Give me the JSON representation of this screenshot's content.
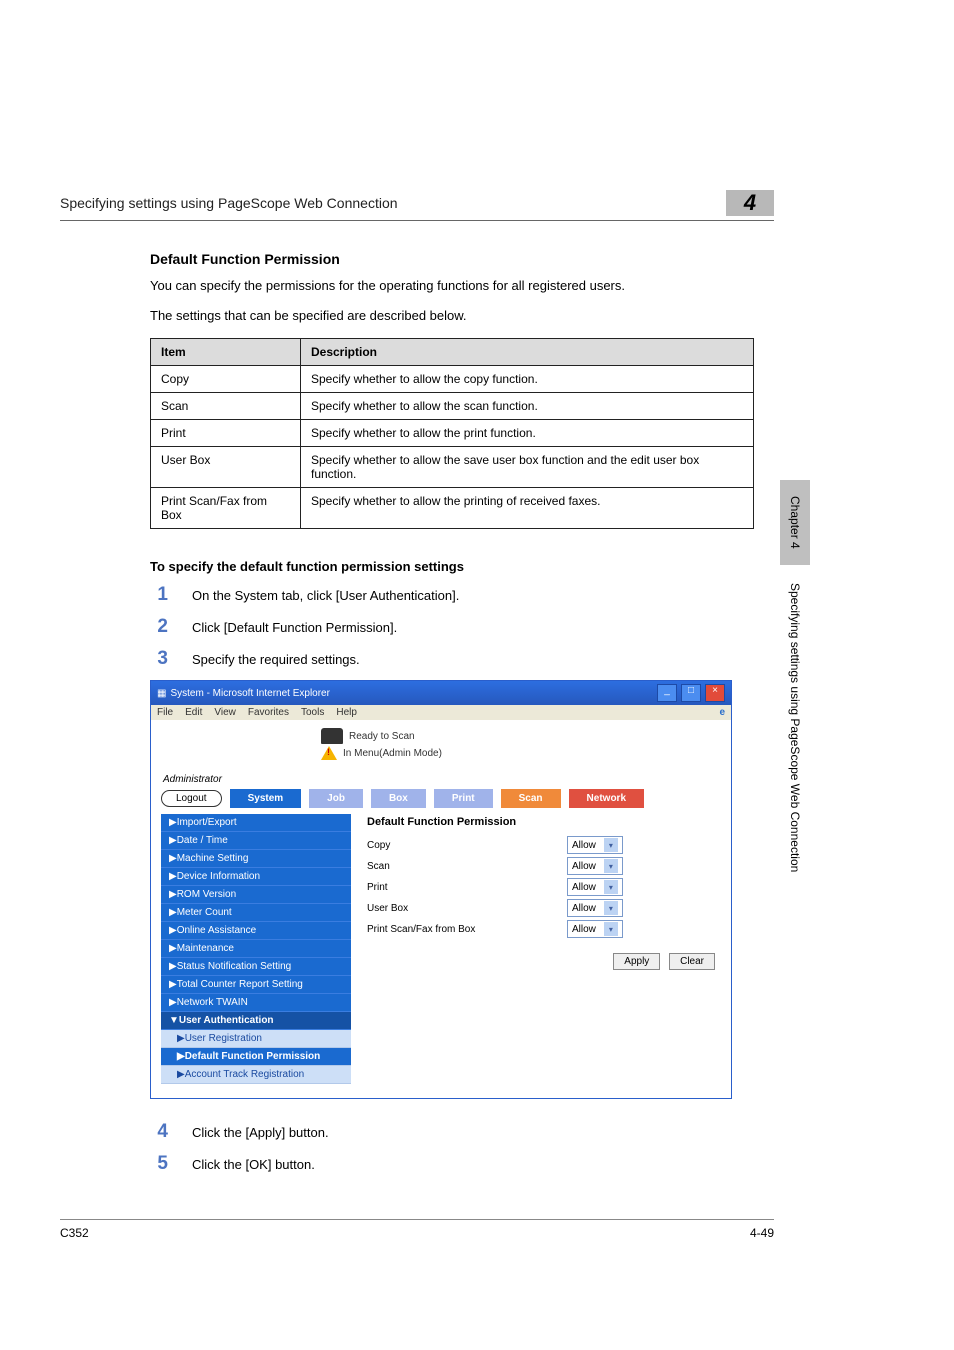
{
  "header": {
    "title": "Specifying settings using PageScope Web Connection",
    "chapter_number": "4"
  },
  "section": {
    "title": "Default Function Permission",
    "para1": "You can specify the permissions for the operating functions for all registered users.",
    "para2": "The settings that can be specified are described below."
  },
  "spec_table": {
    "headers": [
      "Item",
      "Description"
    ],
    "rows": [
      [
        "Copy",
        "Specify whether to allow the copy function."
      ],
      [
        "Scan",
        "Specify whether to allow the scan function."
      ],
      [
        "Print",
        "Specify whether to allow the print function."
      ],
      [
        "User Box",
        "Specify whether to allow the save user box function and the edit user box function."
      ],
      [
        "Print Scan/Fax from Box",
        "Specify whether to allow the printing of received faxes."
      ]
    ]
  },
  "procedure": {
    "title": "To specify the default function permission settings",
    "steps": [
      "On the System tab, click [User Authentication].",
      "Click [Default Function Permission].",
      "Specify the required settings.",
      "Click the [Apply] button.",
      "Click the [OK] button."
    ]
  },
  "browser": {
    "title": "System - Microsoft Internet Explorer",
    "menus": [
      "File",
      "Edit",
      "View",
      "Favorites",
      "Tools",
      "Help"
    ],
    "status_ready": "Ready to Scan",
    "status_menu": "In Menu(Admin Mode)",
    "admin_label": "Administrator",
    "logout": "Logout",
    "tabs": {
      "system": "System",
      "job": "Job",
      "box": "Box",
      "print": "Print",
      "scan": "Scan",
      "network": "Network"
    },
    "sidebar": [
      "▶Import/Export",
      "▶Date / Time",
      "▶Machine Setting",
      "▶Device Information",
      "▶ROM Version",
      "▶Meter Count",
      "▶Online Assistance",
      "▶Maintenance",
      "▶Status Notification Setting",
      "▶Total Counter Report Setting",
      "▶Network TWAIN"
    ],
    "sidebar_expanded": "▼User Authentication",
    "sidebar_subs": [
      "▶User Registration",
      "▶Default Function Permission",
      "▶Account Track Registration"
    ],
    "active_sub_index": 1,
    "main_title": "Default Function Permission",
    "form_rows": [
      {
        "label": "Copy",
        "value": "Allow"
      },
      {
        "label": "Scan",
        "value": "Allow"
      },
      {
        "label": "Print",
        "value": "Allow"
      },
      {
        "label": "User Box",
        "value": "Allow"
      },
      {
        "label": "Print Scan/Fax from Box",
        "value": "Allow"
      }
    ],
    "apply": "Apply",
    "clear": "Clear"
  },
  "side": {
    "chapter_tab": "Chapter 4",
    "vert_text": "Specifying settings using PageScope Web Connection"
  },
  "footer": {
    "left": "C352",
    "right": "4-49"
  }
}
